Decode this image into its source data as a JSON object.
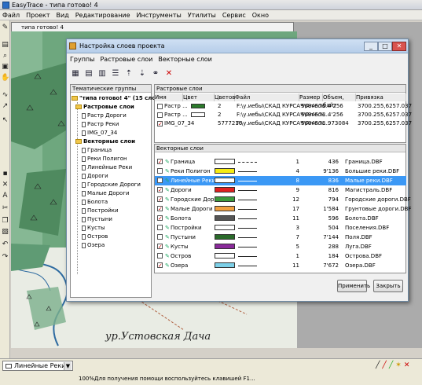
{
  "app": {
    "title": "EasyTrace - типа готово! 4",
    "menu": [
      "Файл",
      "Проект",
      "Вид",
      "Редактирование",
      "Инструменты",
      "Утилиты",
      "Сервис",
      "Окно"
    ]
  },
  "mdi": {
    "title": "типа готово! 4"
  },
  "map": {
    "label": "ур.Устовская Дача"
  },
  "dialog": {
    "title": "Настройка слоев проекта",
    "menu": [
      "Группы",
      "Растровые слои",
      "Векторные слои"
    ],
    "tree_header": "Тематические группы",
    "tree": {
      "root": "\"типа готово! 4\" (15 слоев)",
      "raster_group": "Растровые слои",
      "raster_items": [
        "Растр Дороги",
        "Растр Реки",
        "IMG_07_34"
      ],
      "vector_group": "Векторные слои",
      "vector_items": [
        "Граница",
        "Реки Полигон",
        "Линейные Реки",
        "Дороги",
        "Городские Дороги",
        "Малые Дороги",
        "Болота",
        "Постройки",
        "Пустыни",
        "Кусты",
        "Остров",
        "Озера"
      ]
    },
    "raster_header": "Растровые слои",
    "raster_columns": [
      "Имя",
      "Цвет",
      "Цветов",
      "Файл",
      "Размер",
      "Объем, байт",
      "Привязка"
    ],
    "raster_rows": [
      {
        "name": "Растр ...",
        "colors": "2",
        "file": "F:\\у.иебы\\СКАД КУРСАЧ\\Ал+ск...",
        "size": "5684573",
        "bytes": "4'256",
        "bind": "3700.255,6257.037"
      },
      {
        "name": "Растр ...",
        "colors": "2",
        "file": "F:\\у.иебы\\СКАД КУРСАЧ\\Ал+ск...",
        "size": "5684573",
        "bytes": "4'256",
        "bind": "3700.255,6257.037"
      },
      {
        "name": "IMG_07_34",
        "colors": "5777216",
        "file": "F:\\у.иебы\\СКАД КУРСАЧ\\Ал+ск...",
        "size": "5684573",
        "bytes": "973084",
        "bind": "3700.255,6257.037"
      }
    ],
    "vector_header": "Векторные слои",
    "vector_rows": [
      {
        "name": "Граница",
        "checked": true,
        "color": "#ffffff",
        "num": "1",
        "size": "436",
        "file": "Граница.DBF",
        "style": "dash"
      },
      {
        "name": "Реки Полигон",
        "checked": false,
        "color": "#f7ec12",
        "num": "4",
        "size": "9'136",
        "file": "Большие реки.DBF",
        "style": "solid"
      },
      {
        "name": "Линейные Реки",
        "checked": false,
        "color": "#ffffff",
        "num": "8",
        "size": "836",
        "file": "Малые реки.DBF",
        "style": "solid",
        "selected": true
      },
      {
        "name": "Дороги",
        "checked": true,
        "color": "#e02020",
        "num": "9",
        "size": "816",
        "file": "Магистраль.DBF",
        "style": "solid"
      },
      {
        "name": "Городские Дороги",
        "checked": true,
        "color": "#3c9a3c",
        "num": "12",
        "size": "794",
        "file": "Городские дороги.DBF",
        "style": "solid"
      },
      {
        "name": "Малые Дороги",
        "checked": true,
        "color": "#f0a040",
        "num": "17",
        "size": "1'584",
        "file": "Грунтовые дороги.DBF",
        "style": "solid"
      },
      {
        "name": "Болота",
        "checked": true,
        "color": "#555555",
        "num": "11",
        "size": "596",
        "file": "Болота.DBF",
        "style": "solid"
      },
      {
        "name": "Постройки",
        "checked": false,
        "color": "#ffffff",
        "num": "3",
        "size": "504",
        "file": "Поселения.DBF",
        "style": "solid"
      },
      {
        "name": "Пустыни",
        "checked": false,
        "color": "#2a6a2a",
        "num": "7",
        "size": "7'144",
        "file": "Поля.DBF",
        "style": "solid"
      },
      {
        "name": "Кусты",
        "checked": true,
        "color": "#8a2a9a",
        "num": "5",
        "size": "288",
        "file": "Луга.DBF",
        "style": "solid"
      },
      {
        "name": "Остров",
        "checked": false,
        "color": "#ffffff",
        "num": "1",
        "size": "184",
        "file": "Острова.DBF",
        "style": "solid"
      },
      {
        "name": "Озера",
        "checked": true,
        "color": "#7dd0e8",
        "num": "11",
        "size": "7'672",
        "file": "Озера.DBF",
        "style": "solid"
      }
    ],
    "buttons": {
      "apply": "Применить",
      "close": "Закрыть"
    }
  },
  "status": {
    "layer": "Линейные Реки",
    "zoom": "100%",
    "hint": "Для получения помощи воспользуйтесь клавишей F1..."
  }
}
